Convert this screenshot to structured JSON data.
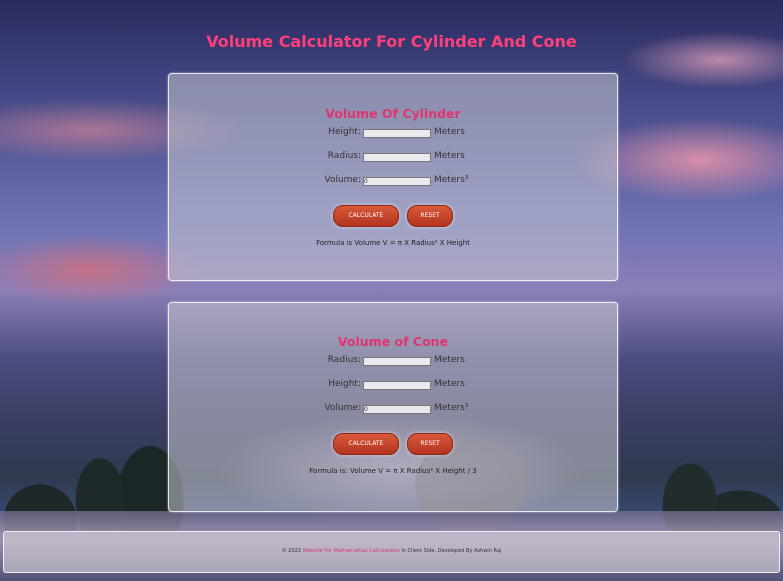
{
  "title": "Volume Calculator For Cylinder And Cone",
  "cylinder": {
    "heading": "Volume Of Cylinder",
    "fields": [
      {
        "label": "Height:",
        "value": "",
        "unit": "Meters"
      },
      {
        "label": "Radius:",
        "value": "",
        "unit": "Meters"
      },
      {
        "label": "Volume:",
        "value": "0",
        "unit": "Meters³"
      }
    ],
    "calculate_label": "CALCULATE",
    "reset_label": "RESET",
    "formula": "Formula is Volume V = π X Radius² X Height"
  },
  "cone": {
    "heading": "Volume of Cone",
    "fields": [
      {
        "label": "Radius:",
        "value": "",
        "unit": "Meters"
      },
      {
        "label": "Height:",
        "value": "",
        "unit": "Meters"
      },
      {
        "label": "Volume:",
        "value": "0",
        "unit": "Meters³"
      }
    ],
    "calculate_label": "CALCULATE",
    "reset_label": "RESET",
    "formula": "Formula is: Volume V = π X Radius² X Height / 3"
  },
  "footer": {
    "prefix": "© 2022",
    "link_text": "Website For Mathematical Calculations",
    "suffix": "In Client Side. Developed By Ashwin Raj"
  }
}
